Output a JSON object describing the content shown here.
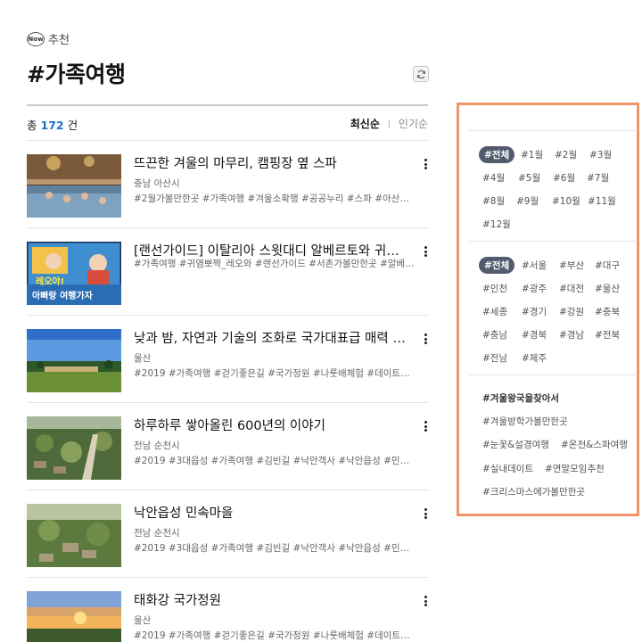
{
  "header": {
    "badge": "Now",
    "section_label": "추천",
    "title": "#가족여행"
  },
  "summary": {
    "prefix": "총",
    "count": "172",
    "suffix": "건"
  },
  "sort": {
    "latest": "최신순",
    "popular": "인기순"
  },
  "items": [
    {
      "title": "뜨끈한 겨울의 마무리, 캠핑장 옆 스파",
      "location": "충남 아산시",
      "tags": "#2월가볼만한곳 #가족여행 #겨울소확행 #공공누리 #스파 #아산가볼…"
    },
    {
      "title": "[랜선가이드] 이탈리아 스윗대디 알베르토와 귀…",
      "location": "",
      "tags": "#가족여행 #귀염뽀짝_레오와 #랜선가이드 #서촌가볼만한곳 #알베르…",
      "thumb_text_1": "레오야!",
      "thumb_text_2": "아빠랑 여행가자"
    },
    {
      "title": "낮과 밤, 자연과 기술의 조화로 국가대표급 매력 …",
      "location": "울산",
      "tags": "#2019 #가족여행 #걷기좋은길 #국가정원 #나룻배체험 #데이트코스…"
    },
    {
      "title": "하루하루 쌓아올린 600년의 이야기",
      "location": "전남 순천시",
      "tags": "#2019 #3대읍성 #가족여행 #김빈길 #낙안객사 #낙안읍성 #민속마…"
    },
    {
      "title": "낙안읍성 민속마을",
      "location": "전남 순천시",
      "tags": "#2019 #3대읍성 #가족여행 #김빈길 #낙안객사 #낙안읍성 #민속마…"
    },
    {
      "title": "태화강 국가정원",
      "location": "울산",
      "tags": "#2019 #가족여행 #걷기좋은길 #국가정원 #나룻배체험 #데이트코스…"
    }
  ],
  "filters": {
    "months": [
      "#전체",
      "#1월",
      "#2월",
      "#3월",
      "#4월",
      "#5월",
      "#6월",
      "#7월",
      "#8월",
      "#9월",
      "#10월",
      "#11월",
      "#12월"
    ],
    "regions": [
      "#전체",
      "#서울",
      "#부산",
      "#대구",
      "#인천",
      "#광주",
      "#대전",
      "#울산",
      "#세종",
      "#경기",
      "#강원",
      "#충북",
      "#충남",
      "#경북",
      "#경남",
      "#전북",
      "#전남",
      "#제주"
    ],
    "themes": [
      "#겨울왕국을찾아서",
      "#겨울방학가볼만한곳",
      "#눈꽃&설경여행",
      "#온천&스파여행",
      "#실내데이트",
      "#연말모임추천",
      "#크리스마스에가볼만한곳"
    ]
  },
  "colors": {
    "accent_count": "#1a73c8",
    "chip_active": "#525b6d",
    "panel_border": "#f0946a"
  }
}
